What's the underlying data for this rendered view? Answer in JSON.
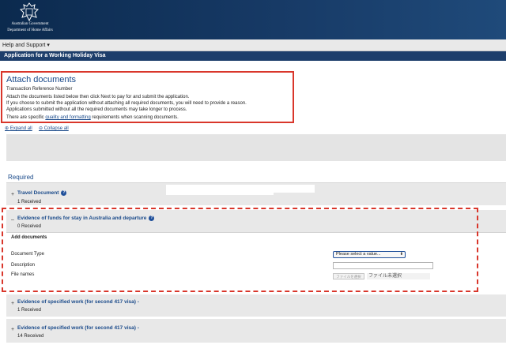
{
  "header": {
    "crest_icon": "coat-of-arms-icon",
    "government": "Australian Government",
    "department": "Department of Home Affairs"
  },
  "helpbar": {
    "help_label": "Help and Support ▾"
  },
  "titlebar": {
    "title": "Application for a Working Holiday Visa"
  },
  "attach": {
    "title": "Attach documents",
    "transaction_ref": "Transaction Reference Number",
    "line1": "Attach the documents listed below then click Next to pay for and submit the application.",
    "line2": "If you choose to submit the application without attaching all required documents, you will need to provide a reason.",
    "line3": "Applications submitted without all the required documents may take longer to process.",
    "line4_pre": "There are specific",
    "line4_link": "quality and formatting",
    "line4_post": "requirements when scanning documents."
  },
  "controls": {
    "expand_all": "Expand all",
    "collapse_all": "Collapse all"
  },
  "required_label": "Required",
  "sections": [
    {
      "toggle": "+",
      "title": "Travel Document",
      "count": "1 Received",
      "has_help": true
    },
    {
      "toggle": "–",
      "title": "Evidence of funds for stay in Australia and departure",
      "count": "0 Received",
      "has_help": true
    },
    {
      "toggle": "+",
      "title": "Evidence of specified work (for second 417 visa) -",
      "count": "1 Received",
      "has_help": false
    },
    {
      "toggle": "+",
      "title": "Evidence of specified work (for second 417 visa) -",
      "count": "14 Received",
      "has_help": false
    }
  ],
  "add_documents": {
    "heading": "Add documents",
    "document_type_label": "Document Type",
    "document_type_value": "Please select a value...",
    "description_label": "Description",
    "file_names_label": "File names",
    "file_button": "ファイルを選択",
    "file_status": "ファイル未選択"
  }
}
